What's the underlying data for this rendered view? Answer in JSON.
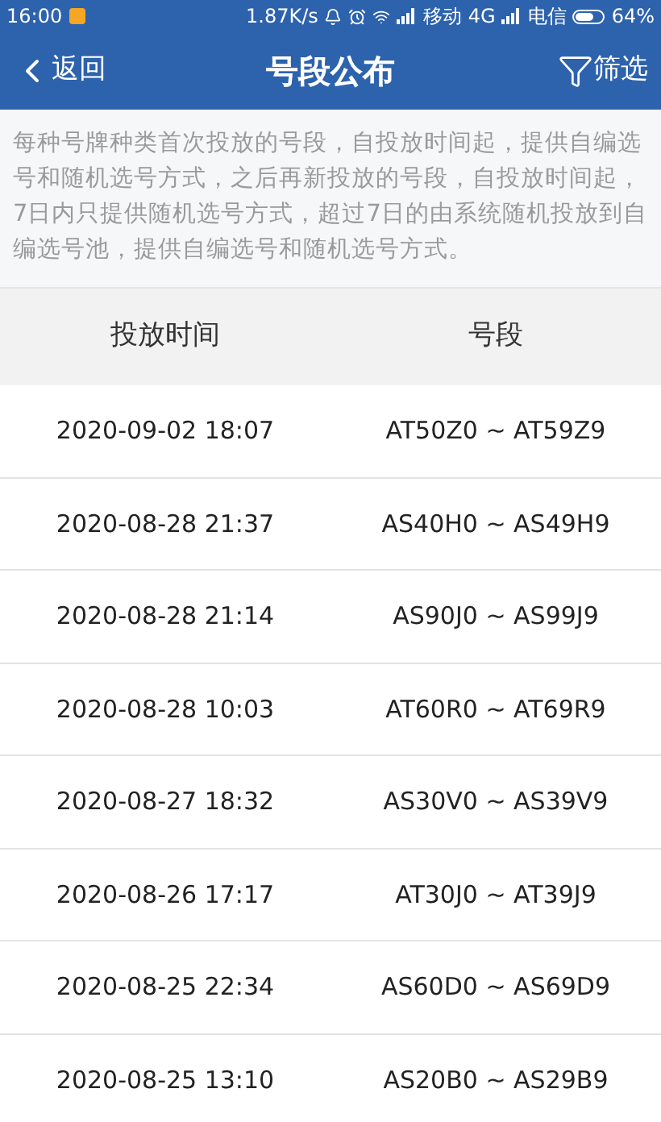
{
  "status_bar": {
    "time": "16:00",
    "speed": "1.87K/s",
    "carrier_1": "移动",
    "network": "4G",
    "carrier_2": "电信",
    "battery": "64%"
  },
  "header": {
    "back": "返回",
    "title": "号段公布",
    "filter": "筛选"
  },
  "notice": "每种号牌种类首次投放的号段，自投放时间起，提供自编选号和随机选号方式，之后再新投放的号段，自投放时间起，7日内只提供随机选号方式，超过7日的由系统随机投放到自编选号池，提供自编选号和随机选号方式。",
  "table": {
    "columns": [
      "投放时间",
      "号段"
    ],
    "rows": [
      {
        "time": "2020-09-02 18:07",
        "range": "AT50Z0 ~ AT59Z9"
      },
      {
        "time": "2020-08-28 21:37",
        "range": "AS40H0 ~ AS49H9"
      },
      {
        "time": "2020-08-28 21:14",
        "range": "AS90J0 ~ AS99J9"
      },
      {
        "time": "2020-08-28 10:03",
        "range": "AT60R0 ~ AT69R9"
      },
      {
        "time": "2020-08-27 18:32",
        "range": "AS30V0 ~ AS39V9"
      },
      {
        "time": "2020-08-26 17:17",
        "range": "AT30J0 ~ AT39J9"
      },
      {
        "time": "2020-08-25 22:34",
        "range": "AS60D0 ~ AS69D9"
      },
      {
        "time": "2020-08-25 13:10",
        "range": "AS20B0 ~ AS29B9"
      }
    ]
  }
}
